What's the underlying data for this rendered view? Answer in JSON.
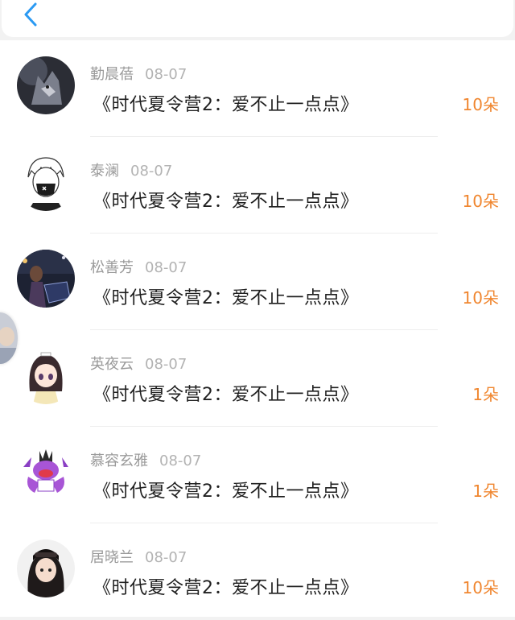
{
  "header": {
    "back_icon": "chevron-left-icon",
    "accent": "#2b9af3"
  },
  "colors": {
    "count": "#f0862f",
    "name": "#9a9a9a",
    "text": "#1f1f1f"
  },
  "records": [
    {
      "name": "勤晨蓓",
      "date": "08-07",
      "gift": "《时代夏令营2：爱不止一点点》",
      "count": "10朵",
      "avatar_icon": "wolf-avatar-icon"
    },
    {
      "name": "泰澜",
      "date": "08-07",
      "gift": "《时代夏令营2：爱不止一点点》",
      "count": "10朵",
      "avatar_icon": "masked-anime-avatar-icon"
    },
    {
      "name": "松善芳",
      "date": "08-07",
      "gift": "《时代夏令营2：爱不止一点点》",
      "count": "10朵",
      "avatar_icon": "night-photo-avatar-icon"
    },
    {
      "name": "英夜云",
      "date": "08-07",
      "gift": "《时代夏令营2：爱不止一点点》",
      "count": "1朵",
      "avatar_icon": "anime-girl-avatar-icon"
    },
    {
      "name": "慕容玄雅",
      "date": "08-07",
      "gift": "《时代夏令营2：爱不止一点点》",
      "count": "1朵",
      "avatar_icon": "purple-monster-avatar-icon"
    },
    {
      "name": "居晓兰",
      "date": "08-07",
      "gift": "《时代夏令营2：爱不止一点点》",
      "count": "10朵",
      "avatar_icon": "girl-photo-avatar-icon"
    }
  ]
}
